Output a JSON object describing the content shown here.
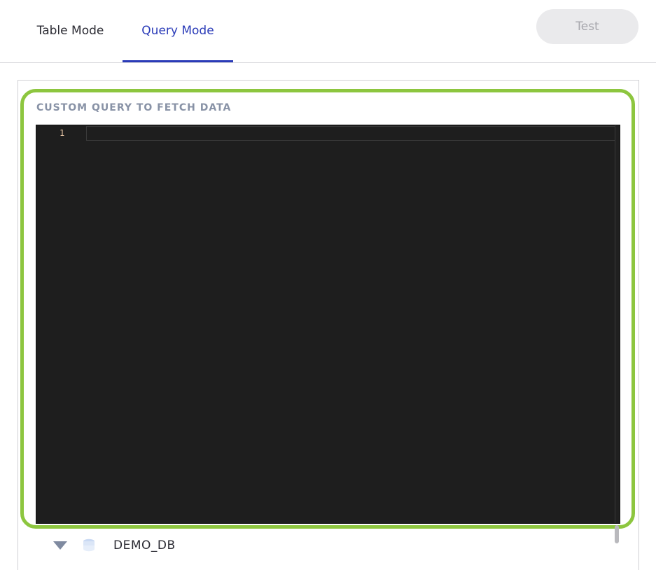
{
  "tabs": {
    "table_mode": "Table Mode",
    "query_mode": "Query Mode"
  },
  "toolbar": {
    "test_label": "Test"
  },
  "query_section": {
    "label": "CUSTOM QUERY TO FETCH DATA",
    "line_number": "1"
  },
  "schema_tree": {
    "database": "DEMO_DB"
  },
  "colors": {
    "accent": "#2a3bb8",
    "highlight": "#8dc63f",
    "editor_bg": "#1e1e1e"
  }
}
